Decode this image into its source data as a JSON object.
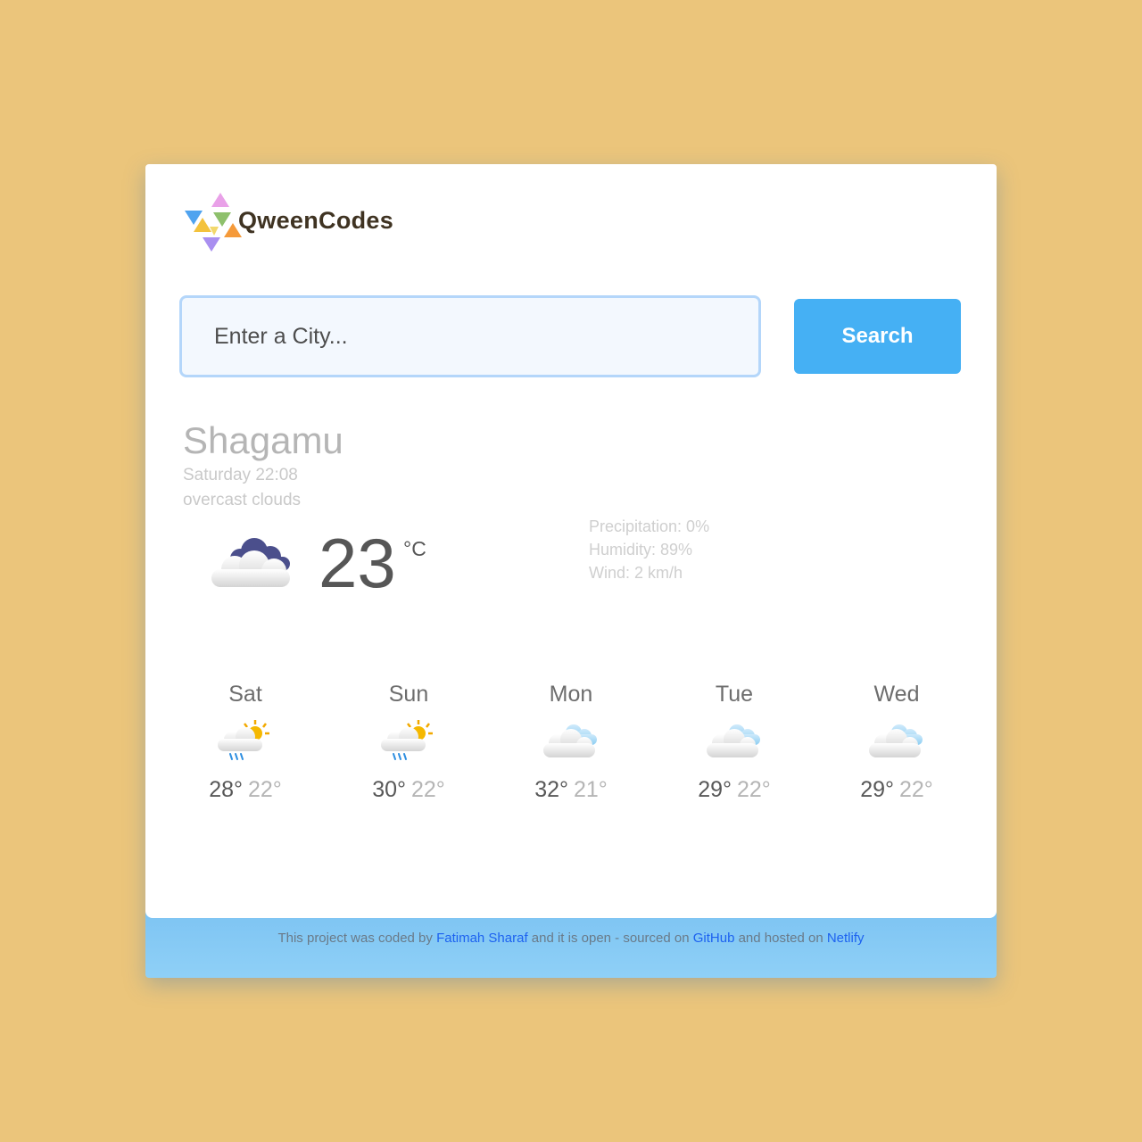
{
  "brand": {
    "name": "QweenCodes"
  },
  "search": {
    "placeholder": "Enter a City...",
    "button_label": "Search"
  },
  "current": {
    "city": "Shagamu",
    "datetime": "Saturday 22:08",
    "description": "overcast clouds",
    "temperature": "23",
    "unit": "°C",
    "icon": "overcast-clouds-icon",
    "precipitation": "Precipitation: 0%",
    "humidity": "Humidity: 89%",
    "wind": "Wind: 2 km/h"
  },
  "forecast": [
    {
      "day": "Sat",
      "max": "28°",
      "min": "22°",
      "icon": "sun-cloud-rain-icon"
    },
    {
      "day": "Sun",
      "max": "30°",
      "min": "22°",
      "icon": "sun-cloud-rain-icon"
    },
    {
      "day": "Mon",
      "max": "32°",
      "min": "21°",
      "icon": "cloudy-icon"
    },
    {
      "day": "Tue",
      "max": "29°",
      "min": "22°",
      "icon": "cloudy-icon"
    },
    {
      "day": "Wed",
      "max": "29°",
      "min": "22°",
      "icon": "cloudy-icon"
    }
  ],
  "footer": {
    "text_1": "This project was coded by ",
    "author": "Fatimah Sharaf",
    "text_2": " and it is open - sourced on ",
    "repo": "GitHub",
    "text_3": " and hosted on ",
    "host": "Netlify"
  },
  "colors": {
    "background": "#ebc57b",
    "accent": "#45b0f4",
    "link": "#1d62f0"
  }
}
